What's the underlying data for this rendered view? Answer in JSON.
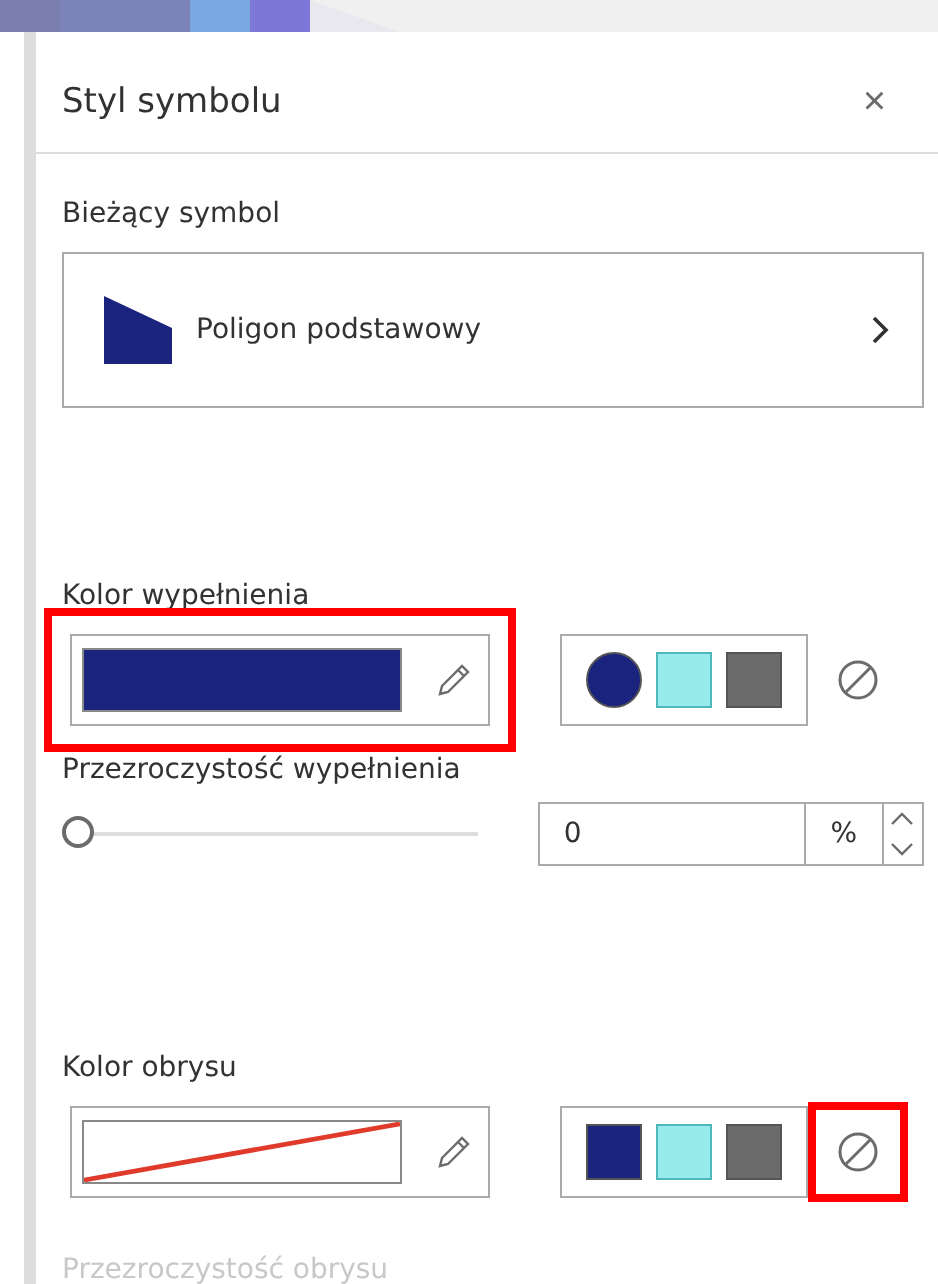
{
  "panel": {
    "title": "Styl symbolu",
    "close": "×"
  },
  "current_symbol": {
    "label": "Bieżący symbol",
    "name": "Poligon podstawowy",
    "color": "#1a237e"
  },
  "fill": {
    "label": "Kolor wypełnienia",
    "color": "#1a237e",
    "highlighted": true,
    "swatches": [
      {
        "color": "#1a237e",
        "selected": true
      },
      {
        "color": "#97ebeb",
        "selected": false
      },
      {
        "color": "#6b6b6b",
        "selected": false
      }
    ],
    "no_color_highlighted": false
  },
  "fill_transparency": {
    "label": "Przezroczystość wypełnienia",
    "level": 0,
    "value": "0",
    "unit": "%"
  },
  "outline": {
    "label": "Kolor obrysu",
    "highlighted": false,
    "swatches": [
      {
        "color": "#1a237e",
        "selected": false
      },
      {
        "color": "#97ebeb",
        "selected": false
      },
      {
        "color": "#6b6b6b",
        "selected": false
      }
    ],
    "no_color_highlighted": true
  },
  "outline_transparency": {
    "label": "Przezroczystość obrysu",
    "disabled": true
  }
}
